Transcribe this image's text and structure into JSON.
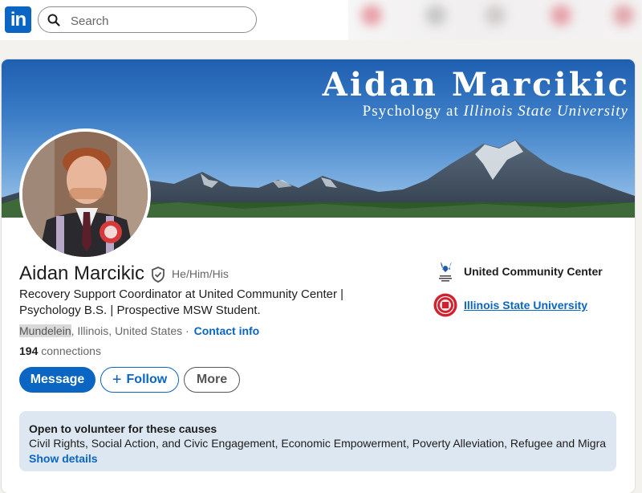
{
  "nav": {
    "logo_text": "in",
    "search_placeholder": "Search"
  },
  "banner": {
    "title": "Aidan Marcikic",
    "subtitle_prefix": "Psychology at ",
    "subtitle_school": "Illinois State University"
  },
  "profile": {
    "name": "Aidan Marcikic",
    "pronouns": "He/Him/His",
    "headline": "Recovery Support Coordinator at United Community Center | Psychology B.S. | Prospective MSW Student.",
    "location_city": "Mundelein",
    "location_rest": ", Illinois, United States",
    "location_sep": " · ",
    "contact_info": "Contact info",
    "connections_count": "194",
    "connections_label": " connections"
  },
  "actions": {
    "message": "Message",
    "follow": "Follow",
    "follow_icon": "+",
    "more": "More"
  },
  "organizations": [
    {
      "name": "United Community Center",
      "logo_text": "United Community Center"
    },
    {
      "name": "Illinois State University"
    }
  ],
  "volunteer": {
    "title": "Open to volunteer for these causes",
    "causes": "Civil Rights, Social Action, and Civic Engagement, Economic Empowerment, Poverty Alleviation, Refugee and Migrant ...",
    "show_details": "Show details"
  },
  "colors": {
    "brand": "#0a66c2",
    "volunteer_bg": "#dde7f1"
  }
}
